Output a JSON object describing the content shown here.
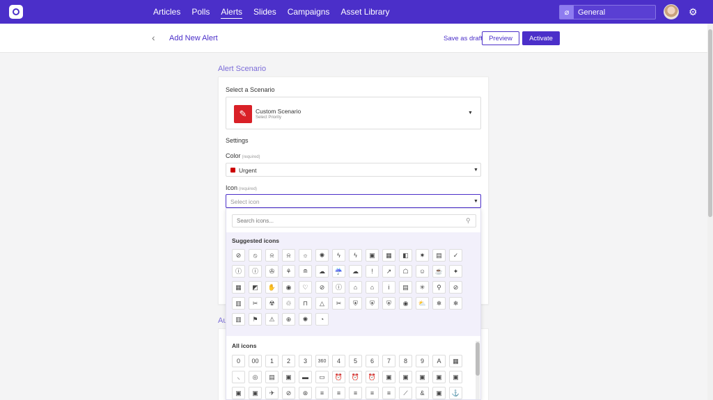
{
  "nav": {
    "items": [
      "Articles",
      "Polls",
      "Alerts",
      "Slides",
      "Campaigns",
      "Asset Library"
    ],
    "active_index": 2
  },
  "workspace": {
    "label": "General"
  },
  "subheader": {
    "title": "Add New Alert",
    "save_draft": "Save as draft",
    "preview": "Preview",
    "activate": "Activate"
  },
  "scenario": {
    "section_label": "Alert Scenario",
    "select_label": "Select a Scenario",
    "title": "Custom Scenario",
    "subtitle": "Select Priority",
    "settings_label": "Settings",
    "color_label": "Color",
    "color_required": "(required)",
    "color_value": "Urgent",
    "color_hex": "#cc0000",
    "icon_label": "Icon",
    "icon_required": "(required)",
    "icon_placeholder": "Select icon"
  },
  "section2": {
    "label": "Au"
  },
  "icon_dropdown": {
    "search_placeholder": "Search icons...",
    "suggested_title": "Suggested icons",
    "suggested": [
      "⊘",
      "⦸",
      "⍾",
      "⍾",
      "☼",
      "✺",
      "ϟ",
      "ϟ",
      "▣",
      "▦",
      "◧",
      "✷",
      "▤",
      "✓",
      "ⓘ",
      "ⓘ",
      "✇",
      "⚘",
      "≘",
      "☁",
      "☔",
      "☁",
      "!",
      "↗",
      "☖",
      "☺",
      "☕",
      "✦",
      "▦",
      "◩",
      "✋",
      "◉",
      "♡",
      "⊘",
      "ⓘ",
      "⌂",
      "⌂",
      "i",
      "▤",
      "✳",
      "⚲",
      "⊘",
      "▥",
      "✂",
      "☢",
      "♲",
      "⊓",
      "△",
      "✂",
      "⛨",
      "⛨",
      "⛨",
      "◉",
      "⛅",
      "❄",
      "❄",
      "▥",
      "⚑",
      "⚠",
      "⊕",
      "✺",
      "◔"
    ],
    "all_title": "All icons",
    "all": [
      "0",
      "00",
      "1",
      "2",
      "3",
      "360",
      "4",
      "5",
      "6",
      "7",
      "8",
      "9",
      "A",
      "▦",
      "⸜",
      "◎",
      "▤",
      "▣",
      "▬",
      "▭",
      "⏰",
      "⏰",
      "⏰",
      "▣",
      "▣",
      "▣",
      "▣",
      "▣",
      "▣",
      "▣",
      "✈",
      "⊘",
      "⊛",
      "≡",
      "≡",
      "≡",
      "≡",
      "≡",
      "⟋",
      "&",
      "▣",
      "⚓"
    ]
  }
}
